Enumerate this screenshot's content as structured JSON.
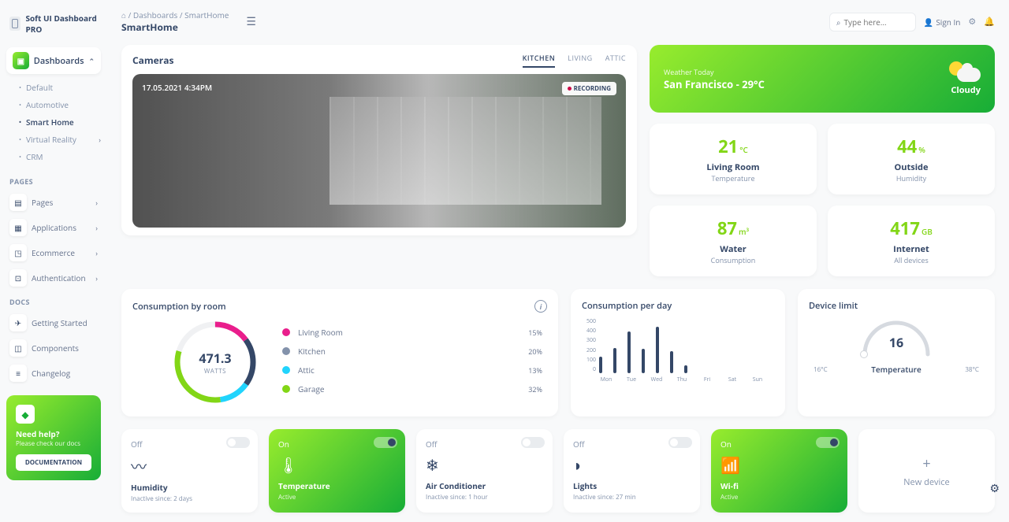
{
  "brand": "Soft UI Dashboard PRO",
  "breadcrumb": {
    "root": "Dashboards",
    "current": "SmartHome"
  },
  "page_title": "SmartHome",
  "search": {
    "placeholder": "Type here..."
  },
  "signin": "Sign In",
  "nav": {
    "dashboards": "Dashboards",
    "dash_items": [
      "Default",
      "Automotive",
      "Smart Home",
      "Virtual Reality",
      "CRM"
    ],
    "dash_active_index": 2,
    "pages_label": "PAGES",
    "pages": [
      "Pages",
      "Applications",
      "Ecommerce",
      "Authentication"
    ],
    "docs_label": "DOCS",
    "docs": [
      "Getting Started",
      "Components",
      "Changelog"
    ]
  },
  "help": {
    "title": "Need help?",
    "subtitle": "Please check our docs",
    "button": "DOCUMENTATION"
  },
  "cameras": {
    "title": "Cameras",
    "tabs": [
      "KITCHEN",
      "LIVING",
      "ATTIC"
    ],
    "active_tab_index": 0,
    "timestamp": "17.05.2021 4:34PM",
    "recording": "RECORDING"
  },
  "weather": {
    "label": "Weather Today",
    "location": "San Francisco - 29°C",
    "condition": "Cloudy"
  },
  "stats": [
    {
      "value": "21",
      "unit": "°C",
      "name": "Living Room",
      "sub": "Temperature"
    },
    {
      "value": "44",
      "unit": "%",
      "name": "Outside",
      "sub": "Humidity"
    },
    {
      "value": "87",
      "unit": "m³",
      "name": "Water",
      "sub": "Consumption"
    },
    {
      "value": "417",
      "unit": "GB",
      "name": "Internet",
      "sub": "All devices"
    }
  ],
  "consumption_room": {
    "title": "Consumption by room",
    "center_value": "471.3",
    "center_label": "WATTS",
    "items": [
      {
        "label": "Living Room",
        "pct": "15%",
        "color": "#e91e8c"
      },
      {
        "label": "Kitchen",
        "pct": "20%",
        "color": "#8392ab"
      },
      {
        "label": "Attic",
        "pct": "13%",
        "color": "#21d4fd"
      },
      {
        "label": "Garage",
        "pct": "32%",
        "color": "#82d616"
      }
    ]
  },
  "chart_data": {
    "type": "bar",
    "title": "Consumption per day",
    "categories": [
      "Mon",
      "Tue",
      "Wed",
      "Thu",
      "Fri",
      "Sat",
      "Sun"
    ],
    "values": [
      150,
      230,
      380,
      220,
      420,
      200,
      70
    ],
    "y_ticks": [
      "500",
      "400",
      "300",
      "200",
      "100",
      "0"
    ],
    "ylim": [
      0,
      500
    ]
  },
  "device_limit": {
    "title": "Device limit",
    "value": "16",
    "min": "16°C",
    "label": "Temperature",
    "max": "38°C"
  },
  "devices": [
    {
      "state": "Off",
      "on": false,
      "name": "Humidity",
      "sub": "Inactive since: 2 days",
      "icon": "humidity"
    },
    {
      "state": "On",
      "on": true,
      "name": "Temperature",
      "sub": "Active",
      "icon": "temperature"
    },
    {
      "state": "Off",
      "on": false,
      "name": "Air Conditioner",
      "sub": "Inactive since: 1 hour",
      "icon": "ac"
    },
    {
      "state": "Off",
      "on": false,
      "name": "Lights",
      "sub": "Inactive since: 27 min",
      "icon": "lights"
    },
    {
      "state": "On",
      "on": true,
      "name": "Wi-fi",
      "sub": "Active",
      "icon": "wifi"
    }
  ],
  "new_device": "New device"
}
